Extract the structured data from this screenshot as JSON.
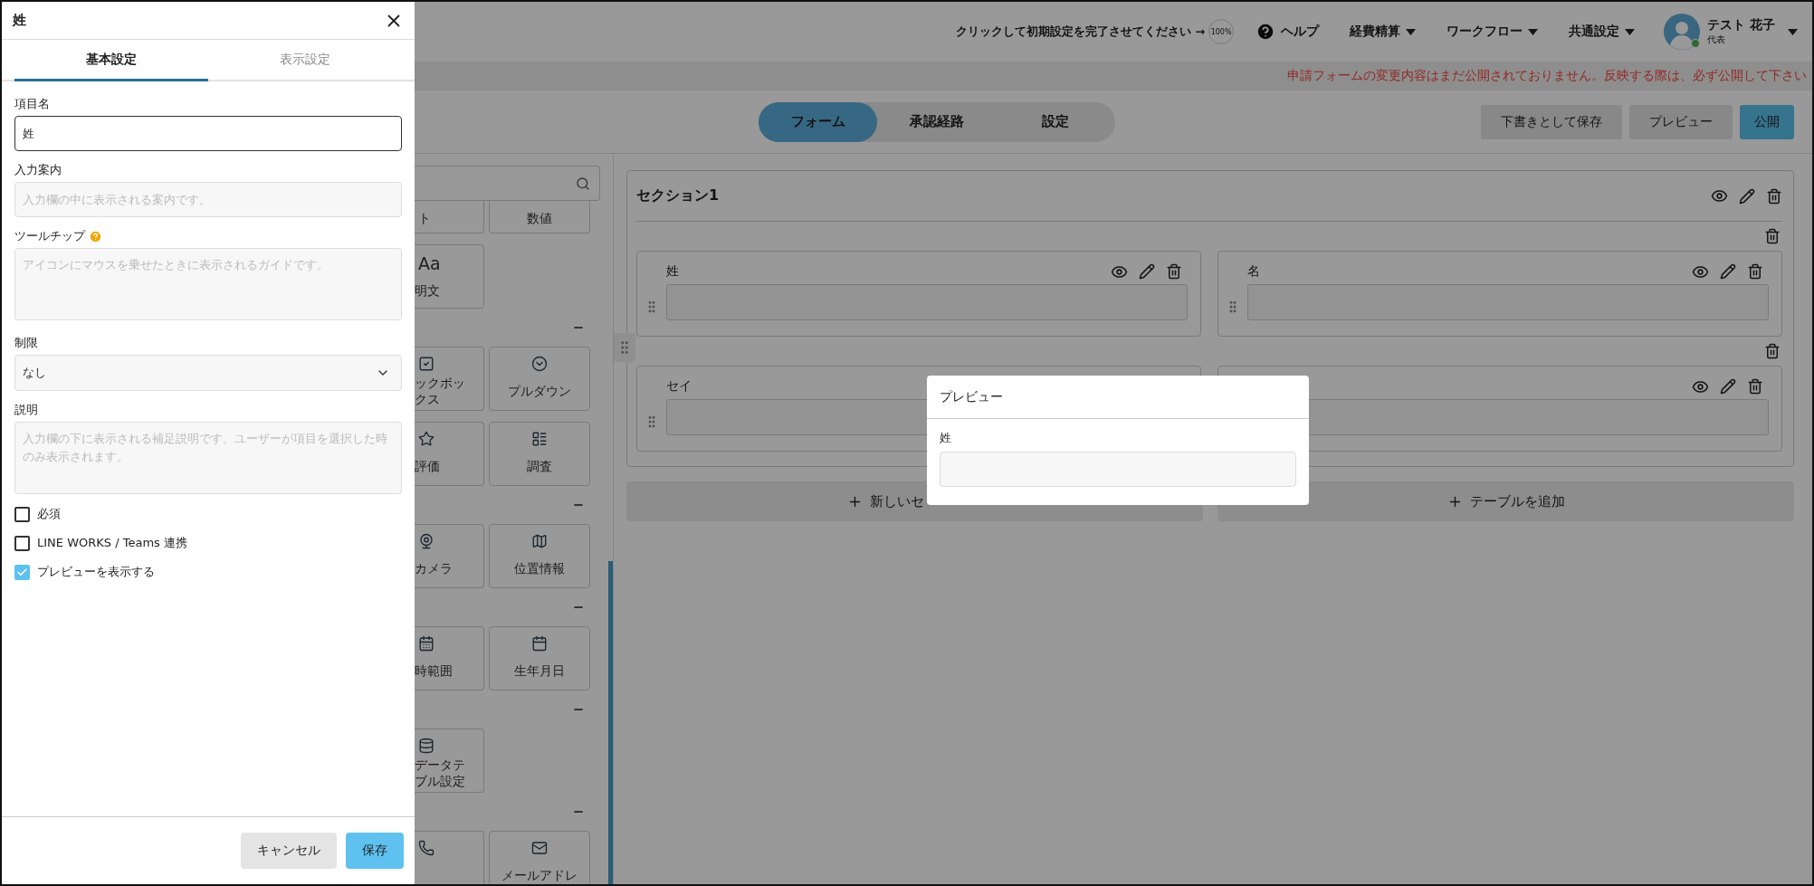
{
  "drawer": {
    "title": "姓",
    "tabs": [
      {
        "label": "基本設定",
        "selected": true
      },
      {
        "label": "表示設定",
        "selected": false
      }
    ],
    "fields": [
      {
        "kind": "input",
        "label": "項目名",
        "value": "姓",
        "focused": true
      },
      {
        "kind": "input",
        "label": "入力案内",
        "placeholder": "入力欄の中に表示される案内です。",
        "focused": false
      },
      {
        "kind": "textarea",
        "label": "ツールチップ",
        "help": true,
        "placeholder": "アイコンにマウスを乗せたときに表示されるガイドです。"
      },
      {
        "kind": "select",
        "label": "制限",
        "value": "なし"
      },
      {
        "kind": "textarea",
        "label": "説明",
        "placeholder": "入力欄の下に表示される補足説明です。ユーザーが項目を選択した時のみ表示されます。"
      }
    ],
    "checkboxes": [
      {
        "label": "必須",
        "checked": false
      },
      {
        "label": "LINE WORKS / Teams 連携",
        "checked": false
      },
      {
        "label": "プレビューを表示する",
        "checked": true
      }
    ],
    "buttons": [
      {
        "label": "キャンセル",
        "kind": "secondary"
      },
      {
        "label": "保存",
        "kind": "primary"
      }
    ]
  },
  "header": {
    "setup_prompt": "クリックして初期設定を完了させてください →",
    "progress": "100%",
    "help": "ヘルプ",
    "menus": [
      "経費精算",
      "ワークフロー",
      "共通設定"
    ],
    "user": {
      "name": "テスト 花子",
      "role": "代表",
      "online": true
    }
  },
  "notice": "申請フォームの変更内容はまだ公開されておりません。反映する際は、必ず公開して下さい",
  "mode_tabs": [
    {
      "label": "フォーム",
      "selected": true
    },
    {
      "label": "承認経路",
      "selected": false
    },
    {
      "label": "設定",
      "selected": false
    }
  ],
  "actions": [
    {
      "label": "下書きとして保存",
      "kind": "secondary"
    },
    {
      "label": "プレビュー",
      "kind": "secondary"
    },
    {
      "label": "公開",
      "kind": "primary"
    }
  ],
  "palette": {
    "groups": [
      [
        {
          "kind": "partial",
          "label": "ト"
        },
        {
          "kind": "partial",
          "label": "数値"
        },
        {
          "kind": "glyph",
          "glyph": "Aa",
          "label": "明文"
        }
      ],
      [
        {
          "kind": "checkbox",
          "label": "ックボックス"
        },
        {
          "kind": "dropdown",
          "label": "プルダウン"
        },
        {
          "kind": "rating",
          "label": "評価"
        },
        {
          "kind": "survey",
          "label": "調査"
        }
      ],
      [
        {
          "kind": "camera",
          "label": "カメラ"
        },
        {
          "kind": "location",
          "label": "位置情報"
        }
      ],
      [
        {
          "kind": "datetime",
          "label": "時範囲"
        },
        {
          "kind": "date",
          "label": "生年月日"
        }
      ],
      [
        {
          "kind": "table",
          "label": "データテブル設定"
        }
      ],
      [
        {
          "kind": "phone"
        },
        {
          "kind": "email",
          "label": "メールアドレ"
        }
      ]
    ]
  },
  "section": {
    "title": "セクション1",
    "rows": [
      [
        {
          "label": "姓",
          "tools": true,
          "grip": true
        },
        {
          "label": "名",
          "tools": true,
          "grip": true
        }
      ],
      [
        {
          "label": "セイ",
          "tools": false,
          "grip": true
        },
        {
          "tools": true,
          "grip": false
        }
      ]
    ]
  },
  "bottom_buttons": [
    "新しいセ",
    "テーブルを追加"
  ],
  "preview": {
    "title": "プレビュー",
    "field_label": "姓"
  }
}
